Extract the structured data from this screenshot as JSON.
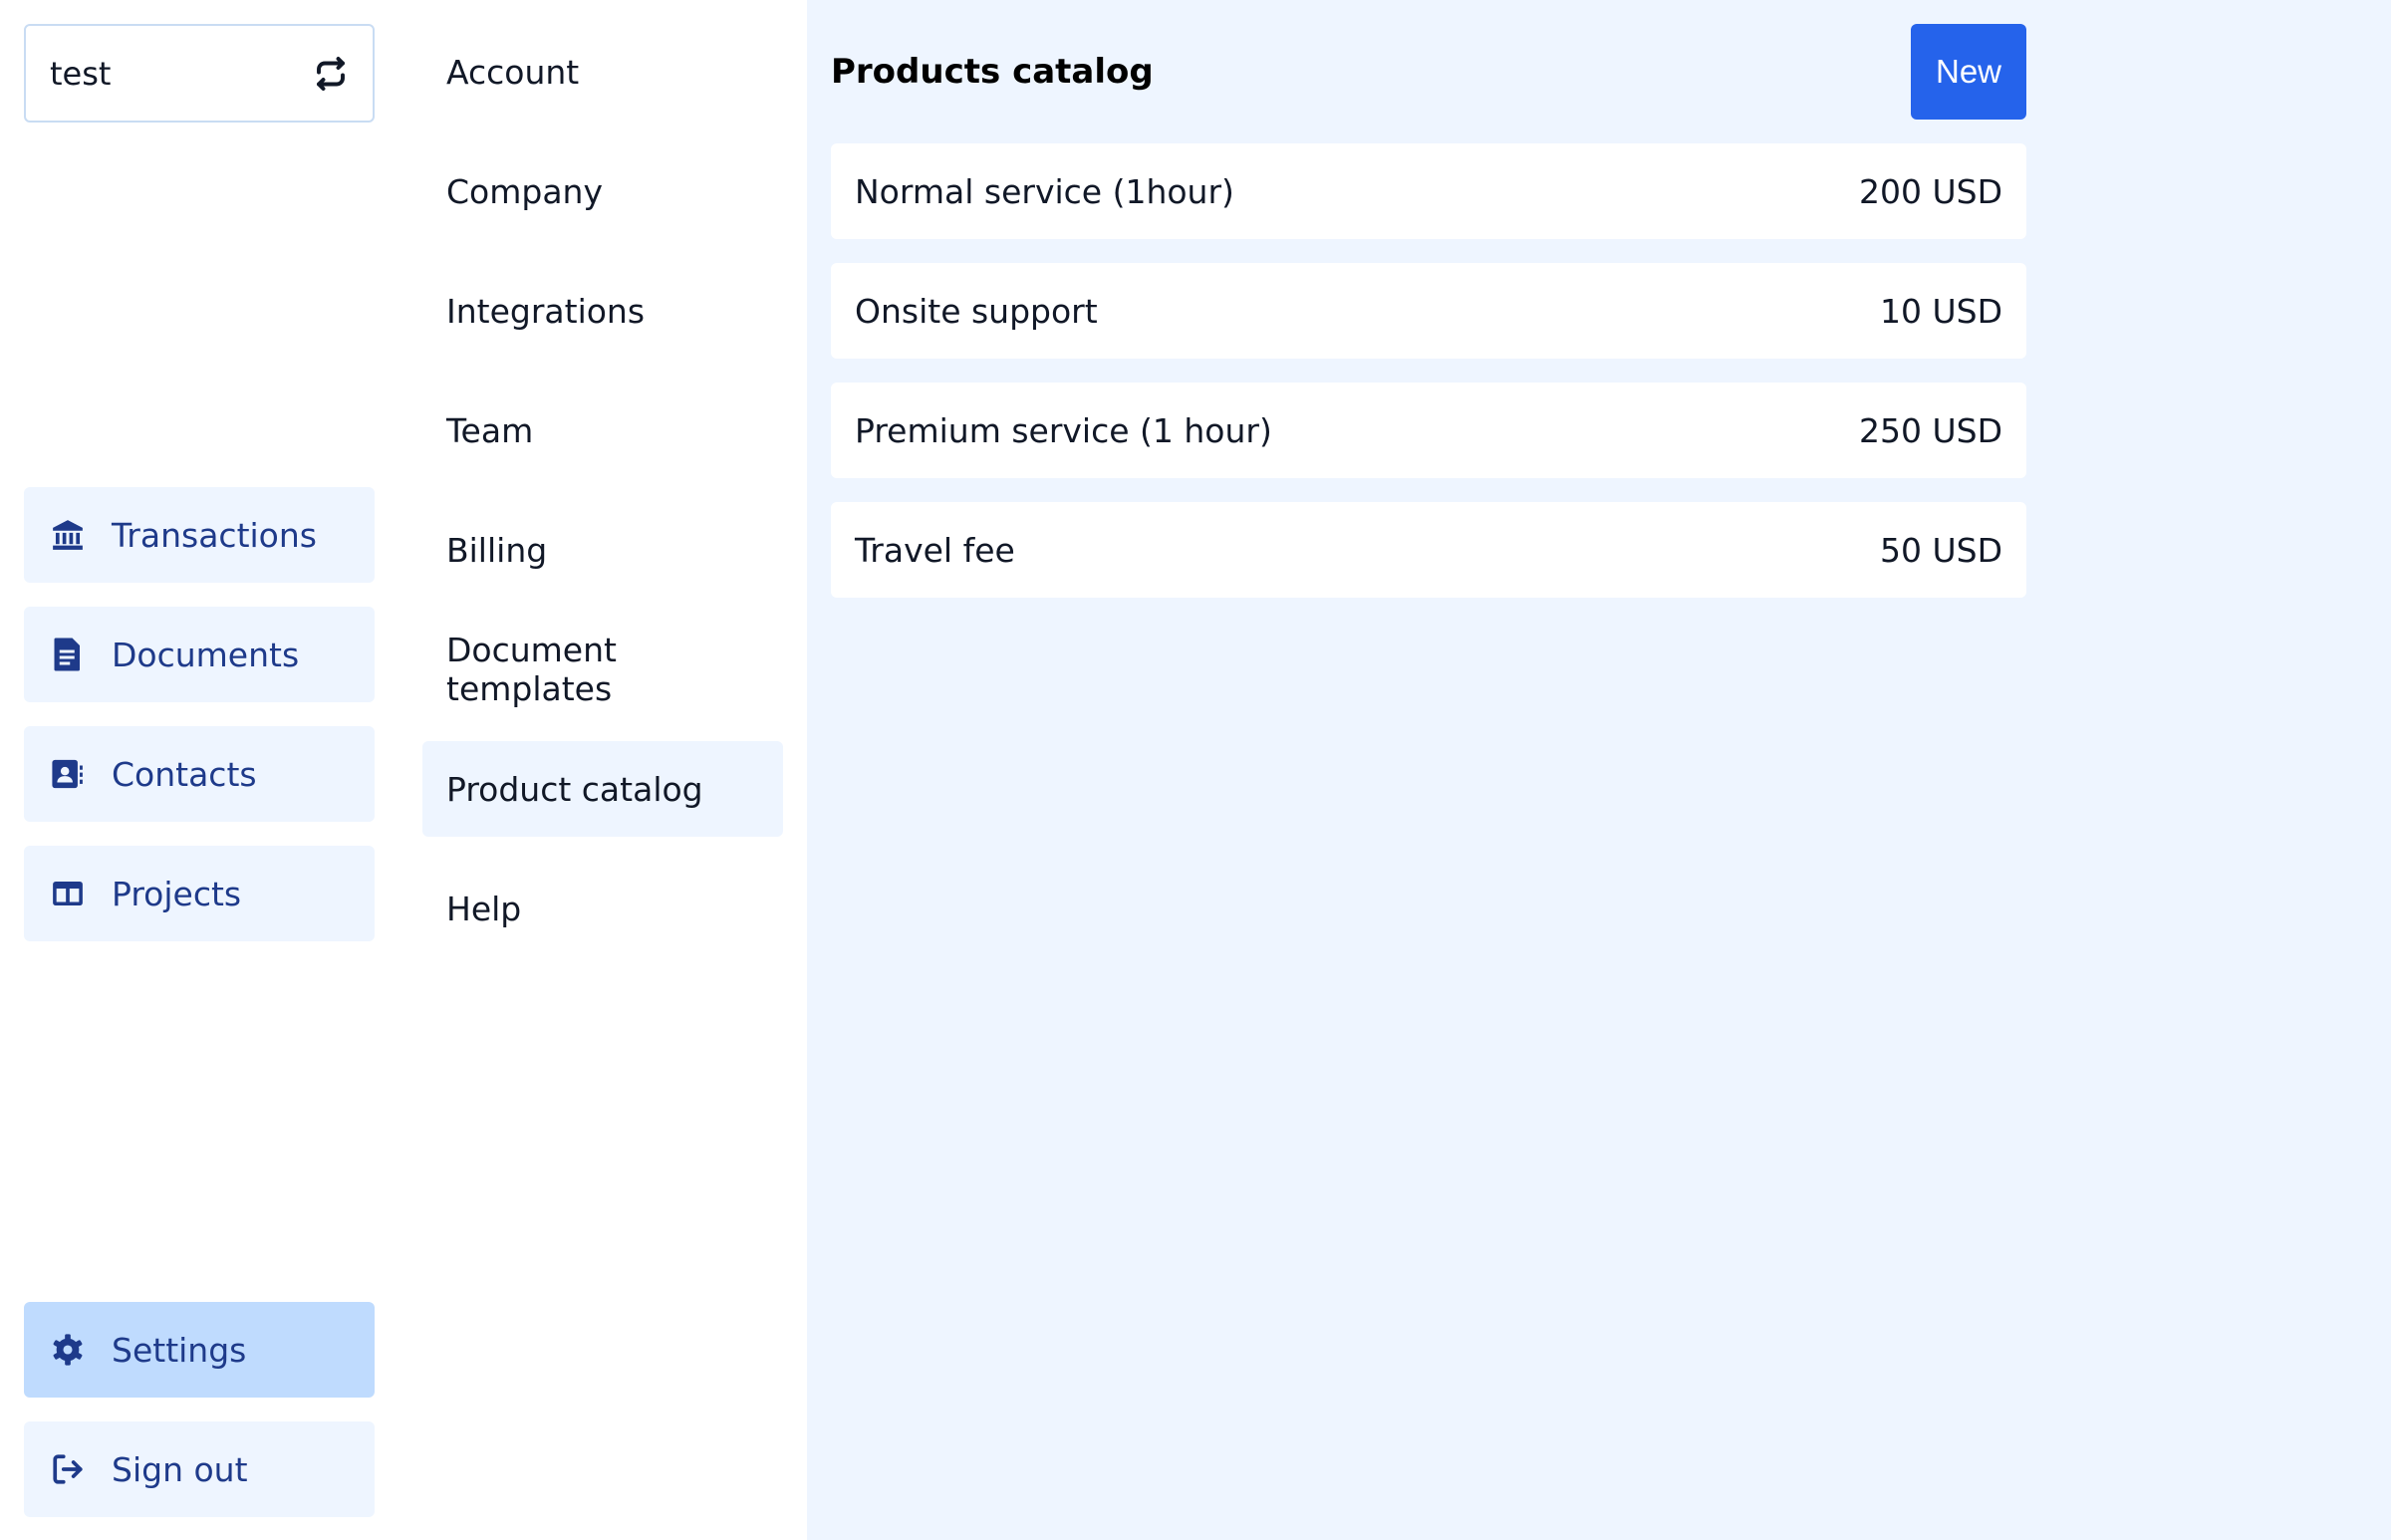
{
  "workspace": {
    "name": "test",
    "switch_icon": "switch-arrows-icon"
  },
  "sidebar": {
    "items": [
      {
        "label": "Transactions",
        "icon": "bank-icon"
      },
      {
        "label": "Documents",
        "icon": "document-icon"
      },
      {
        "label": "Contacts",
        "icon": "contact-card-icon"
      },
      {
        "label": "Projects",
        "icon": "columns-icon"
      }
    ],
    "bottom": [
      {
        "label": "Settings",
        "icon": "gear-icon",
        "active": true
      },
      {
        "label": "Sign out",
        "icon": "sign-out-icon"
      }
    ]
  },
  "settings_menu": {
    "items": [
      {
        "label": "Account"
      },
      {
        "label": "Company"
      },
      {
        "label": "Integrations"
      },
      {
        "label": "Team"
      },
      {
        "label": "Billing"
      },
      {
        "label": "Document templates"
      },
      {
        "label": "Product catalog",
        "active": true
      },
      {
        "label": "Help"
      }
    ]
  },
  "main": {
    "title": "Products catalog",
    "new_label": "New",
    "products": [
      {
        "name": "Normal service (1hour)",
        "price": "200 USD"
      },
      {
        "name": "Onsite support",
        "price": "10 USD"
      },
      {
        "name": "Premium service (1 hour)",
        "price": "250 USD"
      },
      {
        "name": "Travel fee",
        "price": "50 USD"
      }
    ]
  },
  "colors": {
    "accent": "#2563eb",
    "nav_text": "#1e3a8a",
    "nav_bg": "#eef5ff",
    "nav_active_bg": "#bfdbfe",
    "panel_bg": "#eef5ff"
  }
}
